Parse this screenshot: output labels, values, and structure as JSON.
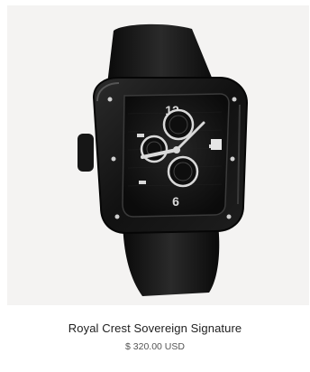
{
  "product": {
    "name": "Royal Crest Sovereign Signature",
    "price": "$ 320.00 USD",
    "image_subject": "watch-icon",
    "dial": {
      "numeral_top": "12",
      "numeral_bottom": "6"
    }
  },
  "colors": {
    "image_background": "#f4f3f2",
    "watch_body": "#121212",
    "accent_silver": "#d9d9d9"
  }
}
